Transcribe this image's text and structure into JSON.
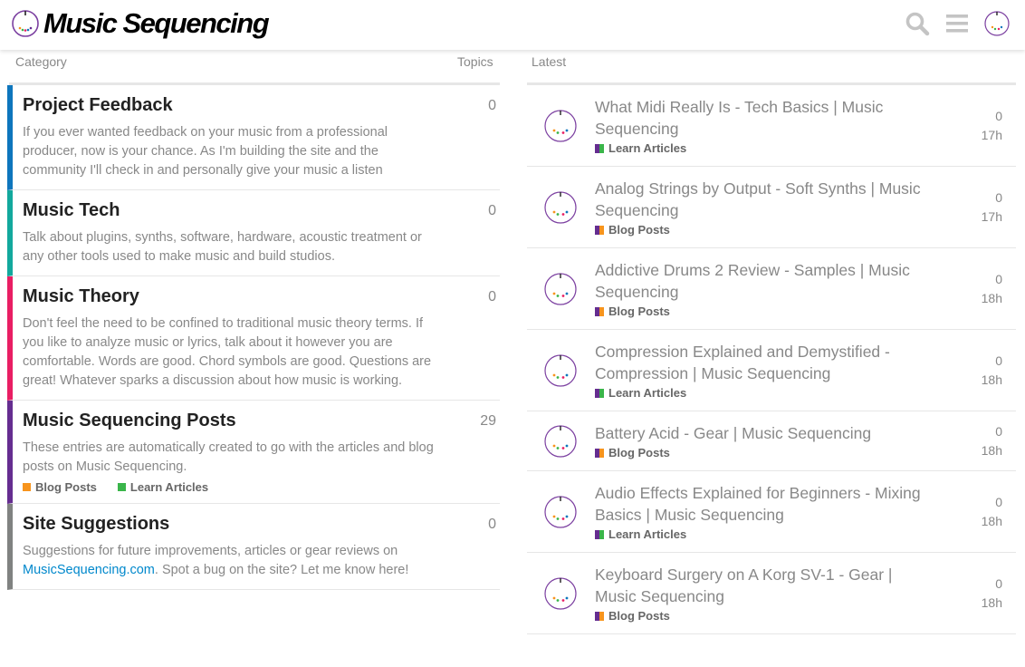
{
  "header": {
    "site_title": "Music Sequencing",
    "icons": [
      "logo-mark-icon",
      "search-icon",
      "hamburger-menu-icon",
      "user-avatar-icon"
    ]
  },
  "columns": {
    "category": "Category",
    "topics": "Topics",
    "latest": "Latest"
  },
  "categories": [
    {
      "name": "Project Feedback",
      "color": "#0e76bd",
      "count": "0",
      "description": "If you ever wanted feedback on your music from a professional producer, now is your chance. As I'm building the site and the community I'll check in and personally give your music a listen"
    },
    {
      "name": "Music Tech",
      "color": "#12a89d",
      "count": "0",
      "description": "Talk about plugins, synths, software, hardware, acoustic treatment or any other tools used to make music and build studios."
    },
    {
      "name": "Music Theory",
      "color": "#e91e63",
      "count": "0",
      "description": "Don't feel the need to be confined to traditional music theory terms. If you like to analyze music or lyrics, talk about it however you are comfortable. Words are good. Chord symbols are good. Questions are great! Whatever sparks a discussion about how music is working."
    },
    {
      "name": "Music Sequencing Posts",
      "color": "#652d90",
      "count": "29",
      "description": "These entries are automatically created to go with the articles and blog posts on Music Sequencing.",
      "subcategories": [
        {
          "label": "Blog Posts",
          "color": "#f7941d"
        },
        {
          "label": "Learn Articles",
          "color": "#3ab54a"
        }
      ]
    },
    {
      "name": "Site Suggestions",
      "color": "#808281",
      "count": "0",
      "description_before": "Suggestions for future improvements, articles or gear reviews on ",
      "description_link": "MusicSequencing.com",
      "description_after": ". Spot a bug on the site? Let me know here!"
    }
  ],
  "latest": [
    {
      "title": "What Midi Really Is - Tech Basics | Music Sequencing",
      "category": "Learn Articles",
      "parent_color": "#652d90",
      "cat_color": "#3ab54a",
      "replies": "0",
      "age": "17h"
    },
    {
      "title": "Analog Strings by Output - Soft Synths | Music Sequencing",
      "category": "Blog Posts",
      "parent_color": "#652d90",
      "cat_color": "#f7941d",
      "replies": "0",
      "age": "17h"
    },
    {
      "title": "Addictive Drums 2 Review - Samples | Music Sequencing",
      "category": "Blog Posts",
      "parent_color": "#652d90",
      "cat_color": "#f7941d",
      "replies": "0",
      "age": "18h"
    },
    {
      "title": "Compression Explained and Demystified - Compression | Music Sequencing",
      "category": "Learn Articles",
      "parent_color": "#652d90",
      "cat_color": "#3ab54a",
      "replies": "0",
      "age": "18h"
    },
    {
      "title": "Battery Acid - Gear | Music Sequencing",
      "category": "Blog Posts",
      "parent_color": "#652d90",
      "cat_color": "#f7941d",
      "replies": "0",
      "age": "18h"
    },
    {
      "title": "Audio Effects Explained for Beginners - Mixing Basics | Music Sequencing",
      "category": "Learn Articles",
      "parent_color": "#652d90",
      "cat_color": "#3ab54a",
      "replies": "0",
      "age": "18h"
    },
    {
      "title": "Keyboard Surgery on A Korg SV-1 - Gear | Music Sequencing",
      "category": "Blog Posts",
      "parent_color": "#652d90",
      "cat_color": "#f7941d",
      "replies": "0",
      "age": "18h"
    }
  ]
}
